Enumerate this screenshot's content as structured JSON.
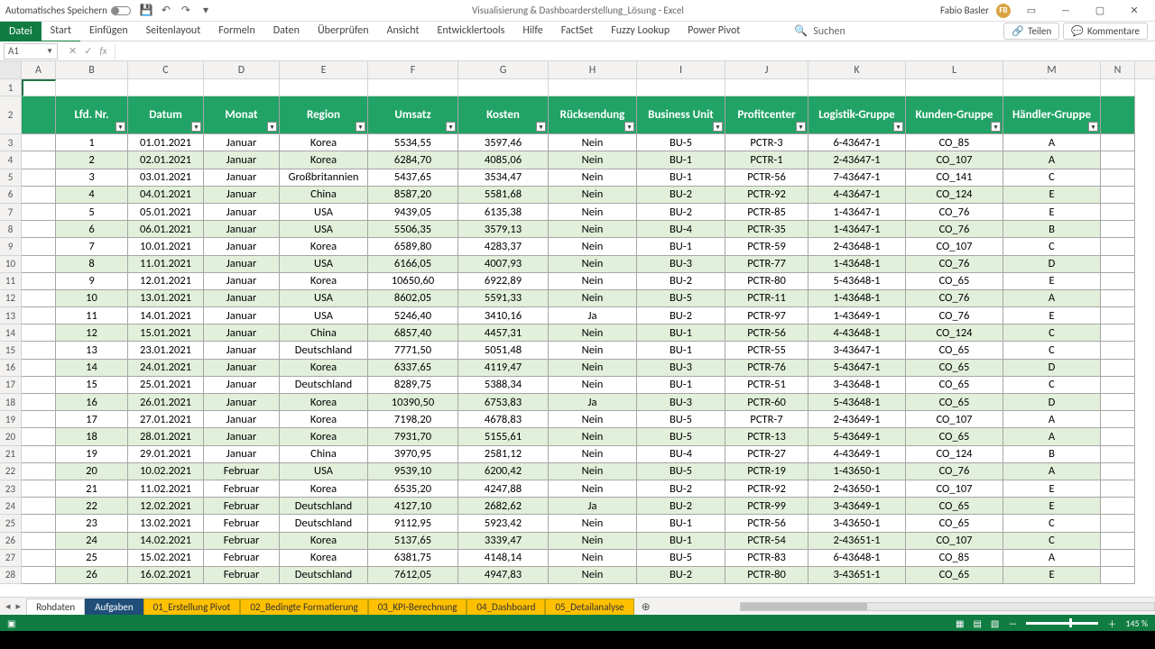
{
  "titlebar": {
    "autosave": "Automatisches Speichern",
    "doc": "Visualisierung & Dashboarderstellung_Lösung  -  Excel",
    "user": "Fabio Basler",
    "initials": "FB"
  },
  "ribbon": {
    "file": "Datei",
    "tabs": [
      "Start",
      "Einfügen",
      "Seitenlayout",
      "Formeln",
      "Daten",
      "Überprüfen",
      "Ansicht",
      "Entwicklertools",
      "Hilfe",
      "FactSet",
      "Fuzzy Lookup",
      "Power Pivot"
    ],
    "search": "Suchen",
    "share": "Teilen",
    "comments": "Kommentare"
  },
  "fx": {
    "namebox": "A1"
  },
  "columns": [
    "A",
    "B",
    "C",
    "D",
    "E",
    "F",
    "G",
    "H",
    "I",
    "J",
    "K",
    "L",
    "M",
    "N"
  ],
  "rownums_start": 1,
  "headers": [
    "Lfd. Nr.",
    "Datum",
    "Monat",
    "Region",
    "Umsatz",
    "Kosten",
    "Rücksendung",
    "Business Unit",
    "Profitcenter",
    "Logistik-Gruppe",
    "Kunden-Gruppe",
    "Händler-Gruppe"
  ],
  "rows": [
    [
      "1",
      "01.01.2021",
      "Januar",
      "Korea",
      "5534,55",
      "3597,46",
      "Nein",
      "BU-5",
      "PCTR-3",
      "6-43647-1",
      "CO_85",
      "A"
    ],
    [
      "2",
      "02.01.2021",
      "Januar",
      "Korea",
      "6284,70",
      "4085,06",
      "Nein",
      "BU-1",
      "PCTR-1",
      "2-43647-1",
      "CO_107",
      "A"
    ],
    [
      "3",
      "03.01.2021",
      "Januar",
      "Großbritannien",
      "5437,65",
      "3534,47",
      "Nein",
      "BU-1",
      "PCTR-56",
      "7-43647-1",
      "CO_141",
      "C"
    ],
    [
      "4",
      "04.01.2021",
      "Januar",
      "China",
      "8587,20",
      "5581,68",
      "Nein",
      "BU-2",
      "PCTR-92",
      "4-43647-1",
      "CO_124",
      "E"
    ],
    [
      "5",
      "05.01.2021",
      "Januar",
      "USA",
      "9439,05",
      "6135,38",
      "Nein",
      "BU-2",
      "PCTR-85",
      "1-43647-1",
      "CO_76",
      "E"
    ],
    [
      "6",
      "06.01.2021",
      "Januar",
      "USA",
      "5506,35",
      "3579,13",
      "Nein",
      "BU-4",
      "PCTR-35",
      "1-43647-1",
      "CO_76",
      "B"
    ],
    [
      "7",
      "10.01.2021",
      "Januar",
      "Korea",
      "6589,80",
      "4283,37",
      "Nein",
      "BU-1",
      "PCTR-59",
      "2-43648-1",
      "CO_107",
      "C"
    ],
    [
      "8",
      "11.01.2021",
      "Januar",
      "USA",
      "6166,05",
      "4007,93",
      "Nein",
      "BU-3",
      "PCTR-77",
      "1-43648-1",
      "CO_76",
      "D"
    ],
    [
      "9",
      "12.01.2021",
      "Januar",
      "Korea",
      "10650,60",
      "6922,89",
      "Nein",
      "BU-2",
      "PCTR-80",
      "5-43648-1",
      "CO_65",
      "E"
    ],
    [
      "10",
      "13.01.2021",
      "Januar",
      "USA",
      "8602,05",
      "5591,33",
      "Nein",
      "BU-5",
      "PCTR-11",
      "1-43648-1",
      "CO_76",
      "A"
    ],
    [
      "11",
      "14.01.2021",
      "Januar",
      "USA",
      "5246,40",
      "3410,16",
      "Ja",
      "BU-2",
      "PCTR-97",
      "1-43649-1",
      "CO_76",
      "E"
    ],
    [
      "12",
      "15.01.2021",
      "Januar",
      "China",
      "6857,40",
      "4457,31",
      "Nein",
      "BU-1",
      "PCTR-56",
      "4-43648-1",
      "CO_124",
      "C"
    ],
    [
      "13",
      "23.01.2021",
      "Januar",
      "Deutschland",
      "7771,50",
      "5051,48",
      "Nein",
      "BU-1",
      "PCTR-55",
      "3-43647-1",
      "CO_65",
      "C"
    ],
    [
      "14",
      "24.01.2021",
      "Januar",
      "Korea",
      "6337,65",
      "4119,47",
      "Nein",
      "BU-3",
      "PCTR-76",
      "5-43647-1",
      "CO_65",
      "D"
    ],
    [
      "15",
      "25.01.2021",
      "Januar",
      "Deutschland",
      "8289,75",
      "5388,34",
      "Nein",
      "BU-1",
      "PCTR-51",
      "3-43648-1",
      "CO_65",
      "C"
    ],
    [
      "16",
      "26.01.2021",
      "Januar",
      "Korea",
      "10390,50",
      "6753,83",
      "Ja",
      "BU-3",
      "PCTR-60",
      "5-43648-1",
      "CO_65",
      "D"
    ],
    [
      "17",
      "27.01.2021",
      "Januar",
      "Korea",
      "7198,20",
      "4678,83",
      "Nein",
      "BU-5",
      "PCTR-7",
      "2-43649-1",
      "CO_107",
      "A"
    ],
    [
      "18",
      "28.01.2021",
      "Januar",
      "Korea",
      "7931,70",
      "5155,61",
      "Nein",
      "BU-5",
      "PCTR-13",
      "5-43649-1",
      "CO_65",
      "A"
    ],
    [
      "19",
      "29.01.2021",
      "Januar",
      "China",
      "3970,95",
      "2581,12",
      "Nein",
      "BU-4",
      "PCTR-27",
      "4-43649-1",
      "CO_124",
      "B"
    ],
    [
      "20",
      "10.02.2021",
      "Februar",
      "USA",
      "9539,10",
      "6200,42",
      "Nein",
      "BU-5",
      "PCTR-19",
      "1-43650-1",
      "CO_76",
      "A"
    ],
    [
      "21",
      "11.02.2021",
      "Februar",
      "Korea",
      "6535,20",
      "4247,88",
      "Nein",
      "BU-2",
      "PCTR-92",
      "2-43650-1",
      "CO_107",
      "E"
    ],
    [
      "22",
      "12.02.2021",
      "Februar",
      "Deutschland",
      "4127,10",
      "2682,62",
      "Ja",
      "BU-2",
      "PCTR-99",
      "3-43649-1",
      "CO_65",
      "E"
    ],
    [
      "23",
      "13.02.2021",
      "Februar",
      "Deutschland",
      "9112,95",
      "5923,42",
      "Nein",
      "BU-1",
      "PCTR-56",
      "3-43650-1",
      "CO_65",
      "C"
    ],
    [
      "24",
      "14.02.2021",
      "Februar",
      "Korea",
      "5137,65",
      "3339,47",
      "Nein",
      "BU-1",
      "PCTR-54",
      "2-43651-1",
      "CO_107",
      "C"
    ],
    [
      "25",
      "15.02.2021",
      "Februar",
      "Korea",
      "6381,75",
      "4148,14",
      "Nein",
      "BU-5",
      "PCTR-83",
      "6-43648-1",
      "CO_85",
      "A"
    ],
    [
      "26",
      "16.02.2021",
      "Februar",
      "Deutschland",
      "7612,05",
      "4947,83",
      "Nein",
      "BU-2",
      "PCTR-80",
      "3-43651-1",
      "CO_65",
      "E"
    ]
  ],
  "sheets": {
    "plain": "Rohdaten",
    "active": "Aufgaben",
    "yellow": [
      "01_Erstellung Pivot",
      "02_Bedingte Formatierung",
      "03_KPI-Berechnung",
      "04_Dashboard",
      "05_Detailanalyse"
    ]
  },
  "status": {
    "zoom": "145 %"
  }
}
